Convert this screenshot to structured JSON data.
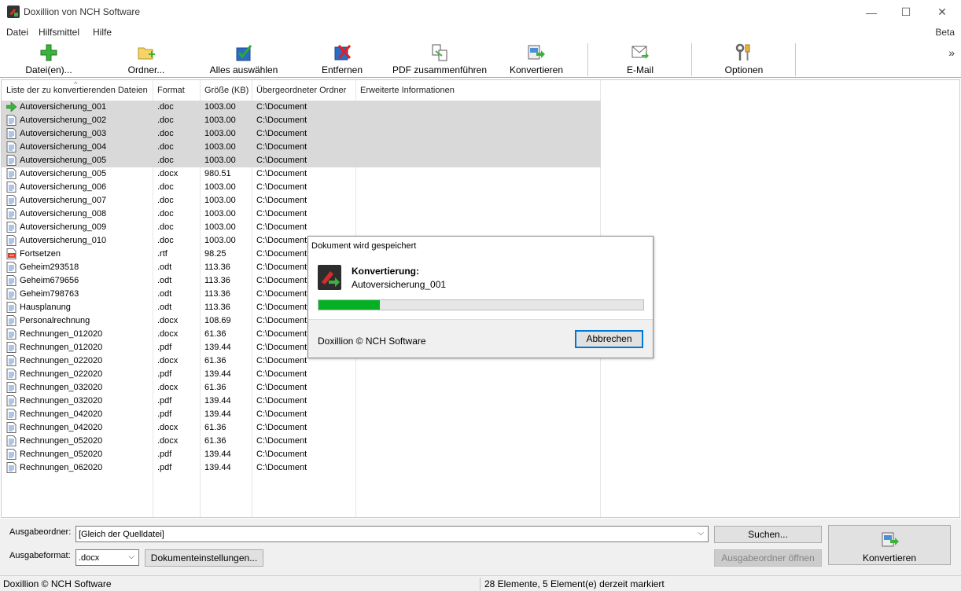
{
  "window": {
    "title": "Doxillion von NCH Software",
    "minimize": "—",
    "maximize": "☐",
    "close": "✕"
  },
  "menu": {
    "items": [
      "Datei",
      "Hilfsmittel",
      "Hilfe"
    ],
    "beta": "Beta"
  },
  "toolbar": {
    "add_files": "Datei(en)...",
    "add_folder": "Ordner...",
    "select_all": "Alles auswählen",
    "remove": "Entfernen",
    "merge_pdf": "PDF zusammenführen",
    "convert": "Konvertieren",
    "email": "E-Mail",
    "options": "Optionen",
    "more": "»"
  },
  "columns": [
    "Liste der zu konvertierenden Dateien",
    "Format",
    "Größe (KB)",
    "Übergeordneter Ordner",
    "Erweiterte Informationen"
  ],
  "files": [
    {
      "name": "Autoversicherung_001",
      "format": ".doc",
      "size": "1003.00",
      "folder": "C:\\Document",
      "selected": true,
      "icon": "arrow-icon"
    },
    {
      "name": "Autoversicherung_002",
      "format": ".doc",
      "size": "1003.00",
      "folder": "C:\\Document",
      "selected": true,
      "icon": "document-icon"
    },
    {
      "name": "Autoversicherung_003",
      "format": ".doc",
      "size": "1003.00",
      "folder": "C:\\Document",
      "selected": true,
      "icon": "document-icon"
    },
    {
      "name": "Autoversicherung_004",
      "format": ".doc",
      "size": "1003.00",
      "folder": "C:\\Document",
      "selected": true,
      "icon": "document-icon"
    },
    {
      "name": "Autoversicherung_005",
      "format": ".doc",
      "size": "1003.00",
      "folder": "C:\\Document",
      "selected": true,
      "icon": "document-icon"
    },
    {
      "name": "Autoversicherung_005",
      "format": ".docx",
      "size": "980.51",
      "folder": "C:\\Document",
      "selected": false,
      "icon": "document-icon"
    },
    {
      "name": "Autoversicherung_006",
      "format": ".doc",
      "size": "1003.00",
      "folder": "C:\\Document",
      "selected": false,
      "icon": "document-icon"
    },
    {
      "name": "Autoversicherung_007",
      "format": ".doc",
      "size": "1003.00",
      "folder": "C:\\Document",
      "selected": false,
      "icon": "document-icon"
    },
    {
      "name": "Autoversicherung_008",
      "format": ".doc",
      "size": "1003.00",
      "folder": "C:\\Document",
      "selected": false,
      "icon": "document-icon"
    },
    {
      "name": "Autoversicherung_009",
      "format": ".doc",
      "size": "1003.00",
      "folder": "C:\\Document",
      "selected": false,
      "icon": "document-icon"
    },
    {
      "name": "Autoversicherung_010",
      "format": ".doc",
      "size": "1003.00",
      "folder": "C:\\Document",
      "selected": false,
      "icon": "document-icon"
    },
    {
      "name": "Fortsetzen",
      "format": ".rtf",
      "size": "98.25",
      "folder": "C:\\Document",
      "selected": false,
      "icon": "rtf-icon"
    },
    {
      "name": "Geheim293518",
      "format": ".odt",
      "size": "113.36",
      "folder": "C:\\Document",
      "selected": false,
      "icon": "document-icon"
    },
    {
      "name": "Geheim679656",
      "format": ".odt",
      "size": "113.36",
      "folder": "C:\\Document",
      "selected": false,
      "icon": "document-icon"
    },
    {
      "name": "Geheim798763",
      "format": ".odt",
      "size": "113.36",
      "folder": "C:\\Document",
      "selected": false,
      "icon": "document-icon"
    },
    {
      "name": "Hausplanung",
      "format": ".odt",
      "size": "113.36",
      "folder": "C:\\Document",
      "selected": false,
      "icon": "document-icon"
    },
    {
      "name": "Personalrechnung",
      "format": ".docx",
      "size": "108.69",
      "folder": "C:\\Document",
      "selected": false,
      "icon": "document-icon"
    },
    {
      "name": "Rechnungen_012020",
      "format": ".docx",
      "size": "61.36",
      "folder": "C:\\Document",
      "selected": false,
      "icon": "document-icon"
    },
    {
      "name": "Rechnungen_012020",
      "format": ".pdf",
      "size": "139.44",
      "folder": "C:\\Document",
      "selected": false,
      "icon": "document-icon"
    },
    {
      "name": "Rechnungen_022020",
      "format": ".docx",
      "size": "61.36",
      "folder": "C:\\Document",
      "selected": false,
      "icon": "document-icon"
    },
    {
      "name": "Rechnungen_022020",
      "format": ".pdf",
      "size": "139.44",
      "folder": "C:\\Document",
      "selected": false,
      "icon": "document-icon"
    },
    {
      "name": "Rechnungen_032020",
      "format": ".docx",
      "size": "61.36",
      "folder": "C:\\Document",
      "selected": false,
      "icon": "document-icon"
    },
    {
      "name": "Rechnungen_032020",
      "format": ".pdf",
      "size": "139.44",
      "folder": "C:\\Document",
      "selected": false,
      "icon": "document-icon"
    },
    {
      "name": "Rechnungen_042020",
      "format": ".pdf",
      "size": "139.44",
      "folder": "C:\\Document",
      "selected": false,
      "icon": "document-icon"
    },
    {
      "name": "Rechnungen_042020",
      "format": ".docx",
      "size": "61.36",
      "folder": "C:\\Document",
      "selected": false,
      "icon": "document-icon"
    },
    {
      "name": "Rechnungen_052020",
      "format": ".docx",
      "size": "61.36",
      "folder": "C:\\Document",
      "selected": false,
      "icon": "document-icon"
    },
    {
      "name": "Rechnungen_052020",
      "format": ".pdf",
      "size": "139.44",
      "folder": "C:\\Document",
      "selected": false,
      "icon": "document-icon"
    },
    {
      "name": "Rechnungen_062020",
      "format": ".pdf",
      "size": "139.44",
      "folder": "C:\\Document",
      "selected": false,
      "icon": "document-icon"
    }
  ],
  "dialog": {
    "title": "Dokument wird gespeichert",
    "heading": "Konvertierung:",
    "file": "Autoversicherung_001",
    "progress": 0.19,
    "footer": "Doxillion © NCH Software",
    "cancel": "Abbrechen"
  },
  "bottom": {
    "output_folder_label": "Ausgabeordner:",
    "output_folder_value": "[Gleich der Quelldatei]",
    "search_button": "Suchen...",
    "output_format_label": "Ausgabeformat:",
    "output_format_value": ".docx",
    "doc_settings_button": "Dokumenteinstellungen...",
    "open_output_button": "Ausgabeordner öffnen",
    "convert_button": "Konvertieren"
  },
  "status": {
    "left": "Doxillion © NCH Software",
    "right": "28 Elemente, 5 Element(e) derzeit markiert"
  },
  "colors": {
    "progress": "#06b025",
    "selection": "#d9d9d9",
    "accent": "#0078d7"
  }
}
